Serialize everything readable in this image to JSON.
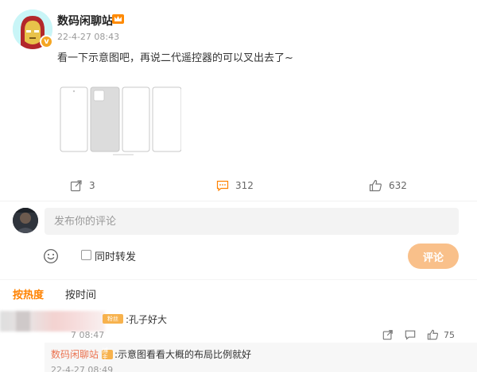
{
  "post": {
    "author": "数码闲聊站",
    "timestamp": "22-4-27 08:43",
    "text": "看一下示意图吧，再说二代遥控器的可以叉出去了~",
    "verify_icon": "v",
    "member_icon": "crown-icon"
  },
  "actions": {
    "share_count": "3",
    "comment_count": "312",
    "like_count": "632"
  },
  "compose": {
    "placeholder": "发布你的评论",
    "repost_label": "同时转发",
    "submit_label": "评论"
  },
  "sort": {
    "hot_label": "按热度",
    "time_label": "按时间"
  },
  "comments": [
    {
      "text": ":孔子好大",
      "badge": "粉丝",
      "time": "7 08:47",
      "like_count": "75",
      "reply": {
        "author": "数码闲聊站",
        "badge": "博主",
        "text": ":示意图看看大概的布局比例就好",
        "time": "22-4-27 08:49"
      }
    }
  ],
  "colors": {
    "accent": "#ff8200",
    "submit": "#f9c08a",
    "reply_author": "#eb7350",
    "badge": "#f7b24d"
  }
}
